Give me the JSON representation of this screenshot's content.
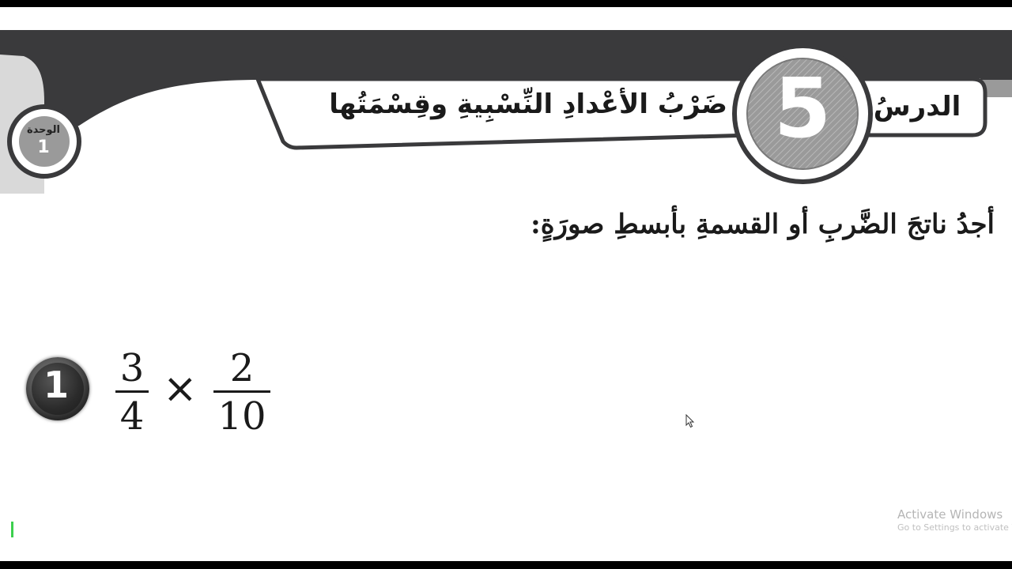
{
  "unit": {
    "label": "الوحدة",
    "number": "1"
  },
  "lesson": {
    "label": "الدرسُ",
    "number": "5",
    "title": "ضَرْبُ الأعْدادِ النِّسْبِيةِ وقِسْمَتُها"
  },
  "instruction": "أجدُ ناتجَ الضَّربِ أو القسمةِ بأبسطِ صورَةٍ:",
  "question": {
    "number": "1",
    "operator": "×",
    "fraction_a": {
      "numerator": "3",
      "denominator": "4"
    },
    "fraction_b": {
      "numerator": "2",
      "denominator": "10"
    }
  },
  "watermark": {
    "title": "Activate Windows",
    "subtitle": "Go to Settings to activate W"
  },
  "colors": {
    "header_band": "#3a3a3c",
    "ribbon_fill": "#ffffff",
    "badge_gray": "#9a9a9a",
    "text_dark": "#1a1a1a"
  }
}
